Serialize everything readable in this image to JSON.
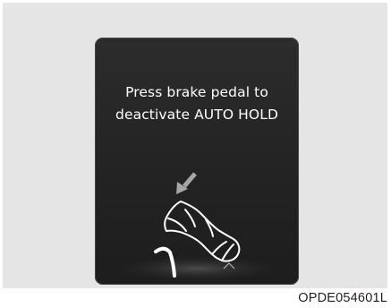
{
  "display": {
    "message_line_1": "Press brake pedal to",
    "message_line_2": "deactivate AUTO HOLD",
    "illustration_icon": "brake-pedal-foot-press-icon"
  },
  "figure": {
    "code": "OPDE054601L"
  },
  "colors": {
    "panel_background": "#e5e5e5",
    "screen_background": "#232323",
    "screen_text": "#ffffff",
    "arrow": "#a6a6a6"
  }
}
